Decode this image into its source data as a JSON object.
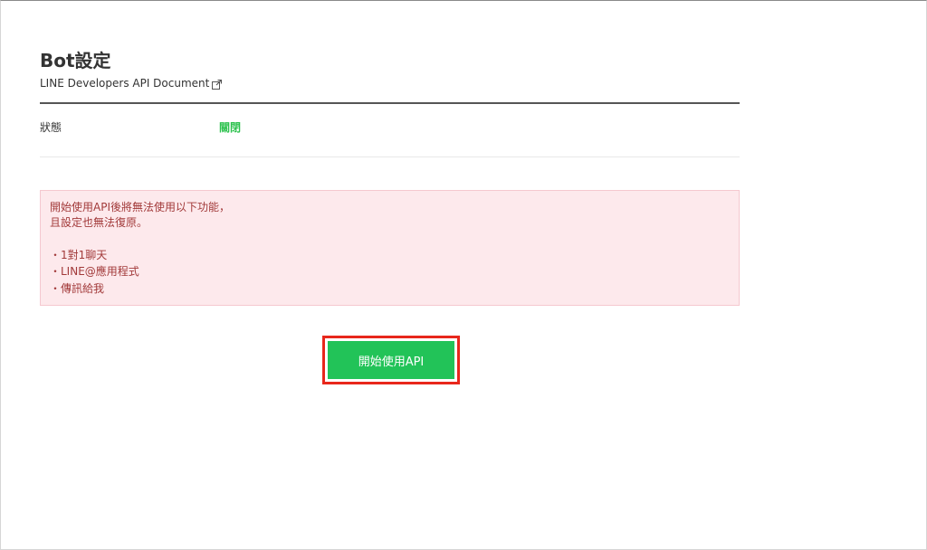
{
  "header": {
    "title": "Bot設定",
    "doc_link": "LINE Developers API Document",
    "doc_link_icon": "external-link-icon"
  },
  "status": {
    "label": "狀態",
    "value": "關閉",
    "value_color": "#2ec24f"
  },
  "warning": {
    "lines": [
      "開始使用API後將無法使用以下功能，",
      "且設定也無法復原。",
      "・1對1聊天",
      "・LINE@應用程式",
      "・傳訊給我"
    ],
    "background_color": "#fde9ec",
    "text_color": "#a23a3a"
  },
  "actions": {
    "start_api_label": "開始使用API",
    "button_color": "#22c358",
    "highlight_color": "#e8271c"
  }
}
